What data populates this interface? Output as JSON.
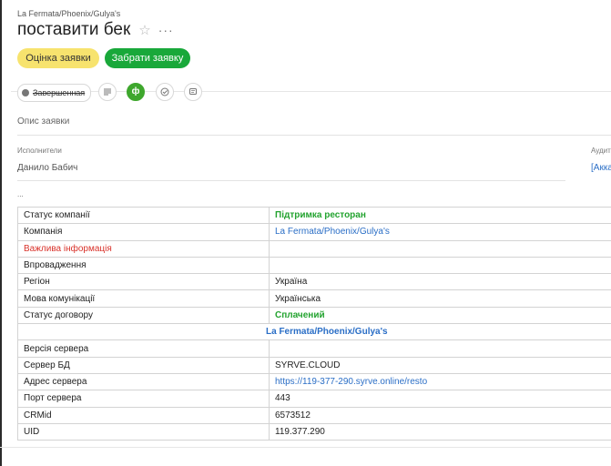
{
  "header": {
    "breadcrumb": "La Fermata/Phoenix/Gulya's",
    "title": "поставити бек",
    "more": "···"
  },
  "actions": {
    "evaluate": "Оцінка заявки",
    "take": "Забрати заявку"
  },
  "colors": {
    "yellow": "#f7e36e",
    "green": "#19a83a",
    "link": "#2a6ec6",
    "red": "#d9332b"
  },
  "toolbar": {
    "status": "Завершенная",
    "icons": [
      "list-icon",
      "company-icon",
      "check-icon",
      "comment-icon"
    ],
    "company_glyph": "ф"
  },
  "description": {
    "label": "Опис заявки"
  },
  "executors": {
    "label": "Исполнители",
    "value": "Данило Бабич"
  },
  "auditors": {
    "label": "Аудит",
    "value": "[Акка"
  },
  "ellipsis": "...",
  "info_table": {
    "rows": [
      {
        "key": "Статус компанії",
        "value": "Підтримка ресторан",
        "style": "green"
      },
      {
        "key": "Компанія",
        "value": "La Fermata/Phoenix/Gulya's",
        "style": "link"
      },
      {
        "key": "Важлива інформація",
        "value": "",
        "style": "red-key"
      },
      {
        "key": "Впровадження",
        "value": "",
        "style": ""
      },
      {
        "key": "Регіон",
        "value": "Україна",
        "style": ""
      },
      {
        "key": "Мова комунікації",
        "value": "Українська",
        "style": ""
      },
      {
        "key": "Статус договору",
        "value": "Сплачений",
        "style": "green"
      }
    ],
    "span_row": "La Fermata/Phoenix/Gulya's",
    "rows2": [
      {
        "key": "Версія сервера",
        "value": "",
        "style": ""
      },
      {
        "key": "Сервер БД",
        "value": "SYRVE.CLOUD",
        "style": ""
      },
      {
        "key": "Адрес сервера",
        "value": "https://119-377-290.syrve.online/resto",
        "style": "link"
      },
      {
        "key": "Порт сервера",
        "value": "443",
        "style": ""
      },
      {
        "key": "CRMid",
        "value": "6573512",
        "style": ""
      },
      {
        "key": "UID",
        "value": "119.377.290",
        "style": ""
      }
    ]
  }
}
